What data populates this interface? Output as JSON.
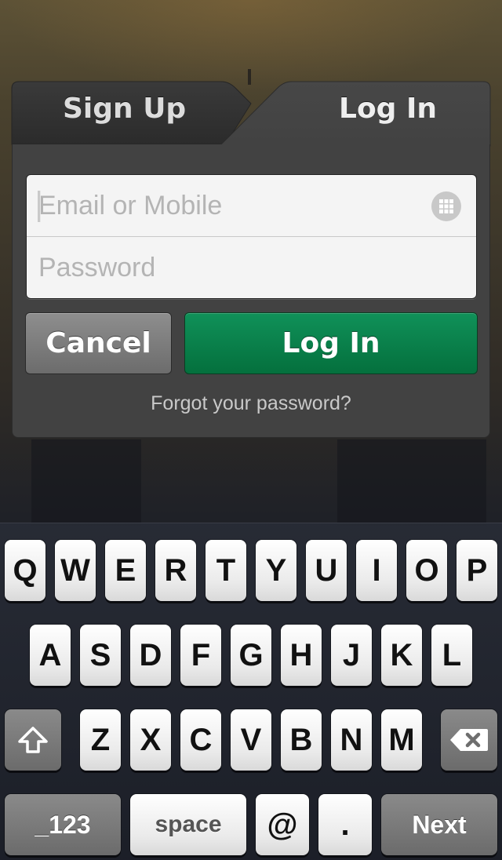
{
  "tabs": {
    "signup_label": "Sign Up",
    "login_label": "Log In"
  },
  "form": {
    "email_placeholder": "Email or Mobile",
    "email_value": "",
    "password_placeholder": "Password",
    "password_value": ""
  },
  "buttons": {
    "cancel_label": "Cancel",
    "login_label": "Log In"
  },
  "links": {
    "forgot_password": "Forgot your password?"
  },
  "keyboard": {
    "row1": [
      "Q",
      "W",
      "E",
      "R",
      "T",
      "Y",
      "U",
      "I",
      "O",
      "P"
    ],
    "row2": [
      "A",
      "S",
      "D",
      "F",
      "G",
      "H",
      "J",
      "K",
      "L"
    ],
    "row3": [
      "Z",
      "X",
      "C",
      "V",
      "B",
      "N",
      "M"
    ],
    "shift_icon": "shift-arrow-icon",
    "delete_icon": "backspace-icon",
    "numbers_label": "_123",
    "space_label": "space",
    "at_label": "@",
    "dot_label": ".",
    "next_label": "Next"
  },
  "colors": {
    "login_button": "#0b8049",
    "cancel_button": "#7a7a7a",
    "panel": "#424242"
  }
}
